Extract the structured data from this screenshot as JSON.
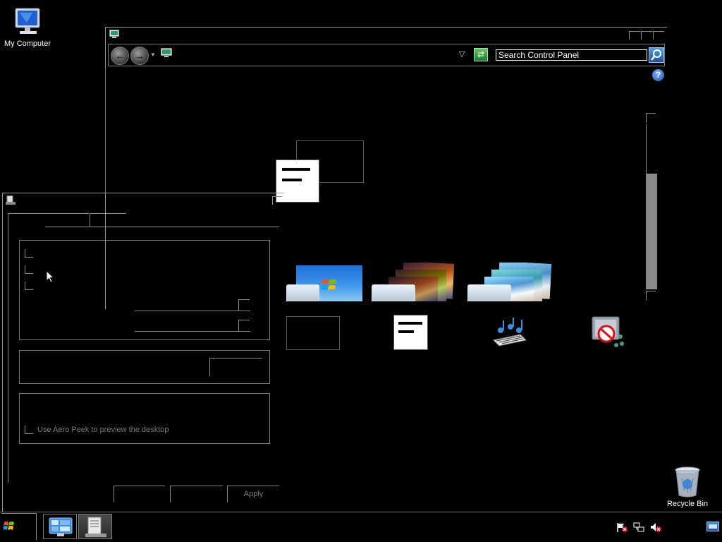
{
  "desktop": {
    "my_computer_label": "My Computer",
    "recycle_bin_label": "Recycle Bin"
  },
  "control_panel": {
    "search_placeholder": "Search Control Panel",
    "search_value": "Search Control Panel",
    "help_glyph": "?",
    "nav_back_glyph": "←",
    "nav_forward_glyph": "→",
    "dropdown_glyph": "▽",
    "refresh_glyph": "⇄",
    "themes": [
      {
        "name": "windows-7-theme",
        "style": "sky"
      },
      {
        "name": "architecture-theme",
        "style": "sunset"
      },
      {
        "name": "landscapes-theme",
        "style": "landscape"
      }
    ],
    "bottom_icons": [
      "desktop-background-icon",
      "window-color-icon",
      "sounds-icon",
      "screen-saver-icon"
    ]
  },
  "dialog": {
    "aero_peek_label": "Use Aero Peek to preview the desktop",
    "apply_label": "Apply",
    "ok_label": "",
    "cancel_label": ""
  },
  "taskbar": {
    "start_icon": "windows-flag-icon",
    "items": [
      "control-panel-taskbar-item",
      "properties-taskbar-item"
    ],
    "tray_icons": [
      "action-center-flag-icon",
      "network-icon",
      "volume-muted-icon",
      "show-desktop-icon"
    ]
  },
  "colors": {
    "background": "#000000",
    "accent_blue": "#1e4fa8",
    "outline": "#8a8a8a"
  }
}
